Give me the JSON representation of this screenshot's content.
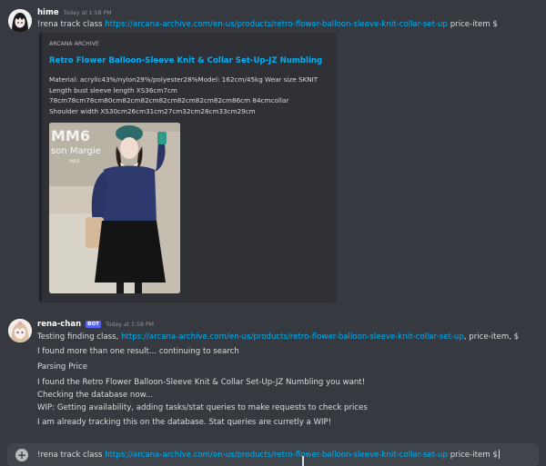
{
  "messages": [
    {
      "author": "hime",
      "timestamp": "Today at 1:58 PM",
      "command_prefix": "!rena track class ",
      "command_link": "https://arcana-archive.com/en-us/products/retro-flower-balloon-sleeve-knit-collar-set-up",
      "command_suffix": " price-item $",
      "embed": {
        "provider": "ARCANA ARCHIVE",
        "title": "Retro Flower Balloon-Sleeve Knit & Collar Set-Up-JZ Numbling",
        "description_lines": [
          "Material: acrylic43%/nylon29%/polyester28%Model: 162cm/45kg Wear size SKNIT",
          "Length bust sleeve length XS36cm7cm",
          "78cm78cm78cm80cm82cm82cm82cm82cm82cm82cm86cm 84cmcollar",
          "Shoulder width XS30cm26cm31cm27cm32cm28cm33cm29cm"
        ],
        "image_sign_big": "MM6",
        "image_sign_small": "son Margie",
        "image_sign_city": "PARIS"
      }
    },
    {
      "author": "rena-chan",
      "badge": "BOT",
      "timestamp": "Today at 1:58 PM",
      "first_prefix": "Testing finding class, ",
      "first_link": "https://arcana-archive.com/en-us/products/retro-flower-balloon-sleeve-knit-collar-set-up",
      "first_suffix": ", price-item, $",
      "lines": [
        "I found more than one result... continuing to search",
        "Parsing Price",
        "I found the Retro Flower Balloon-Sleeve Knit & Collar Set-Up-JZ Numbling you want!",
        "Checking the database now...",
        "WIP: Getting availability, adding tasks/stat queries to make requests to check prices",
        "I am already tracking this on the database. Stat queries are curretly a WIP!"
      ]
    }
  ],
  "input": {
    "text_prefix": "!rena track class ",
    "text_link": "https://arcana-archive.com/en-us/products/retro-flower-balloon-sleeve-knit-collar-set-up",
    "text_suffix": " price-item $"
  },
  "colors": {
    "background": "#36393f",
    "link": "#00b0f4",
    "embed_bg": "#2f3136",
    "input_bg": "#40444b",
    "bot_badge": "#5865f2"
  }
}
